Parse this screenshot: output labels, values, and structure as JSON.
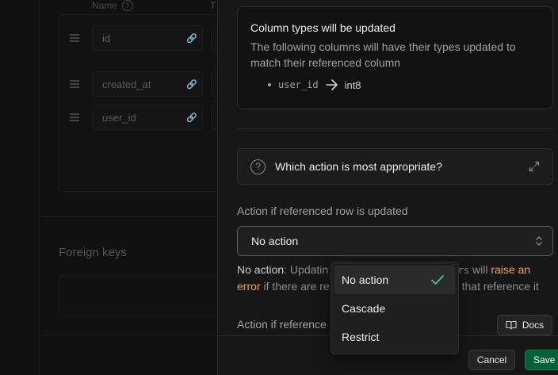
{
  "background": {
    "header_name": "Name",
    "header_type": "T",
    "rows": [
      {
        "name": "id"
      },
      {
        "name": "created_at"
      },
      {
        "name": "user_id"
      }
    ],
    "foreign_keys_title": "Foreign keys"
  },
  "panel": {
    "notice": {
      "title": "Column types will be updated",
      "description": "The following columns will have their types updated to match their referenced column",
      "items": [
        {
          "column": "user_id",
          "type": "int8"
        }
      ]
    },
    "accordion_label": "Which action is most appropriate?",
    "update_label": "Action if referenced row is updated",
    "update_value": "No action",
    "help": {
      "lead": "No action",
      "line1_rest": ": Updatin",
      "line1_code": "sers",
      "line1_after": " will ",
      "line1_warn": "raise an",
      "line2_warn": "error",
      "line2_mid": " if there are re",
      "line2_end": " that reference it"
    },
    "delete_label": "Action if reference",
    "docs_label": "Docs",
    "cancel_label": "Cancel",
    "save_label": "Save"
  },
  "dropdown": {
    "options": [
      {
        "label": "No action",
        "selected": true
      },
      {
        "label": "Cascade",
        "selected": false
      },
      {
        "label": "Restrict",
        "selected": false
      }
    ]
  },
  "colors": {
    "accent_green": "#3ecf8e",
    "warning": "#f1a35b",
    "save_bg": "#006239"
  }
}
